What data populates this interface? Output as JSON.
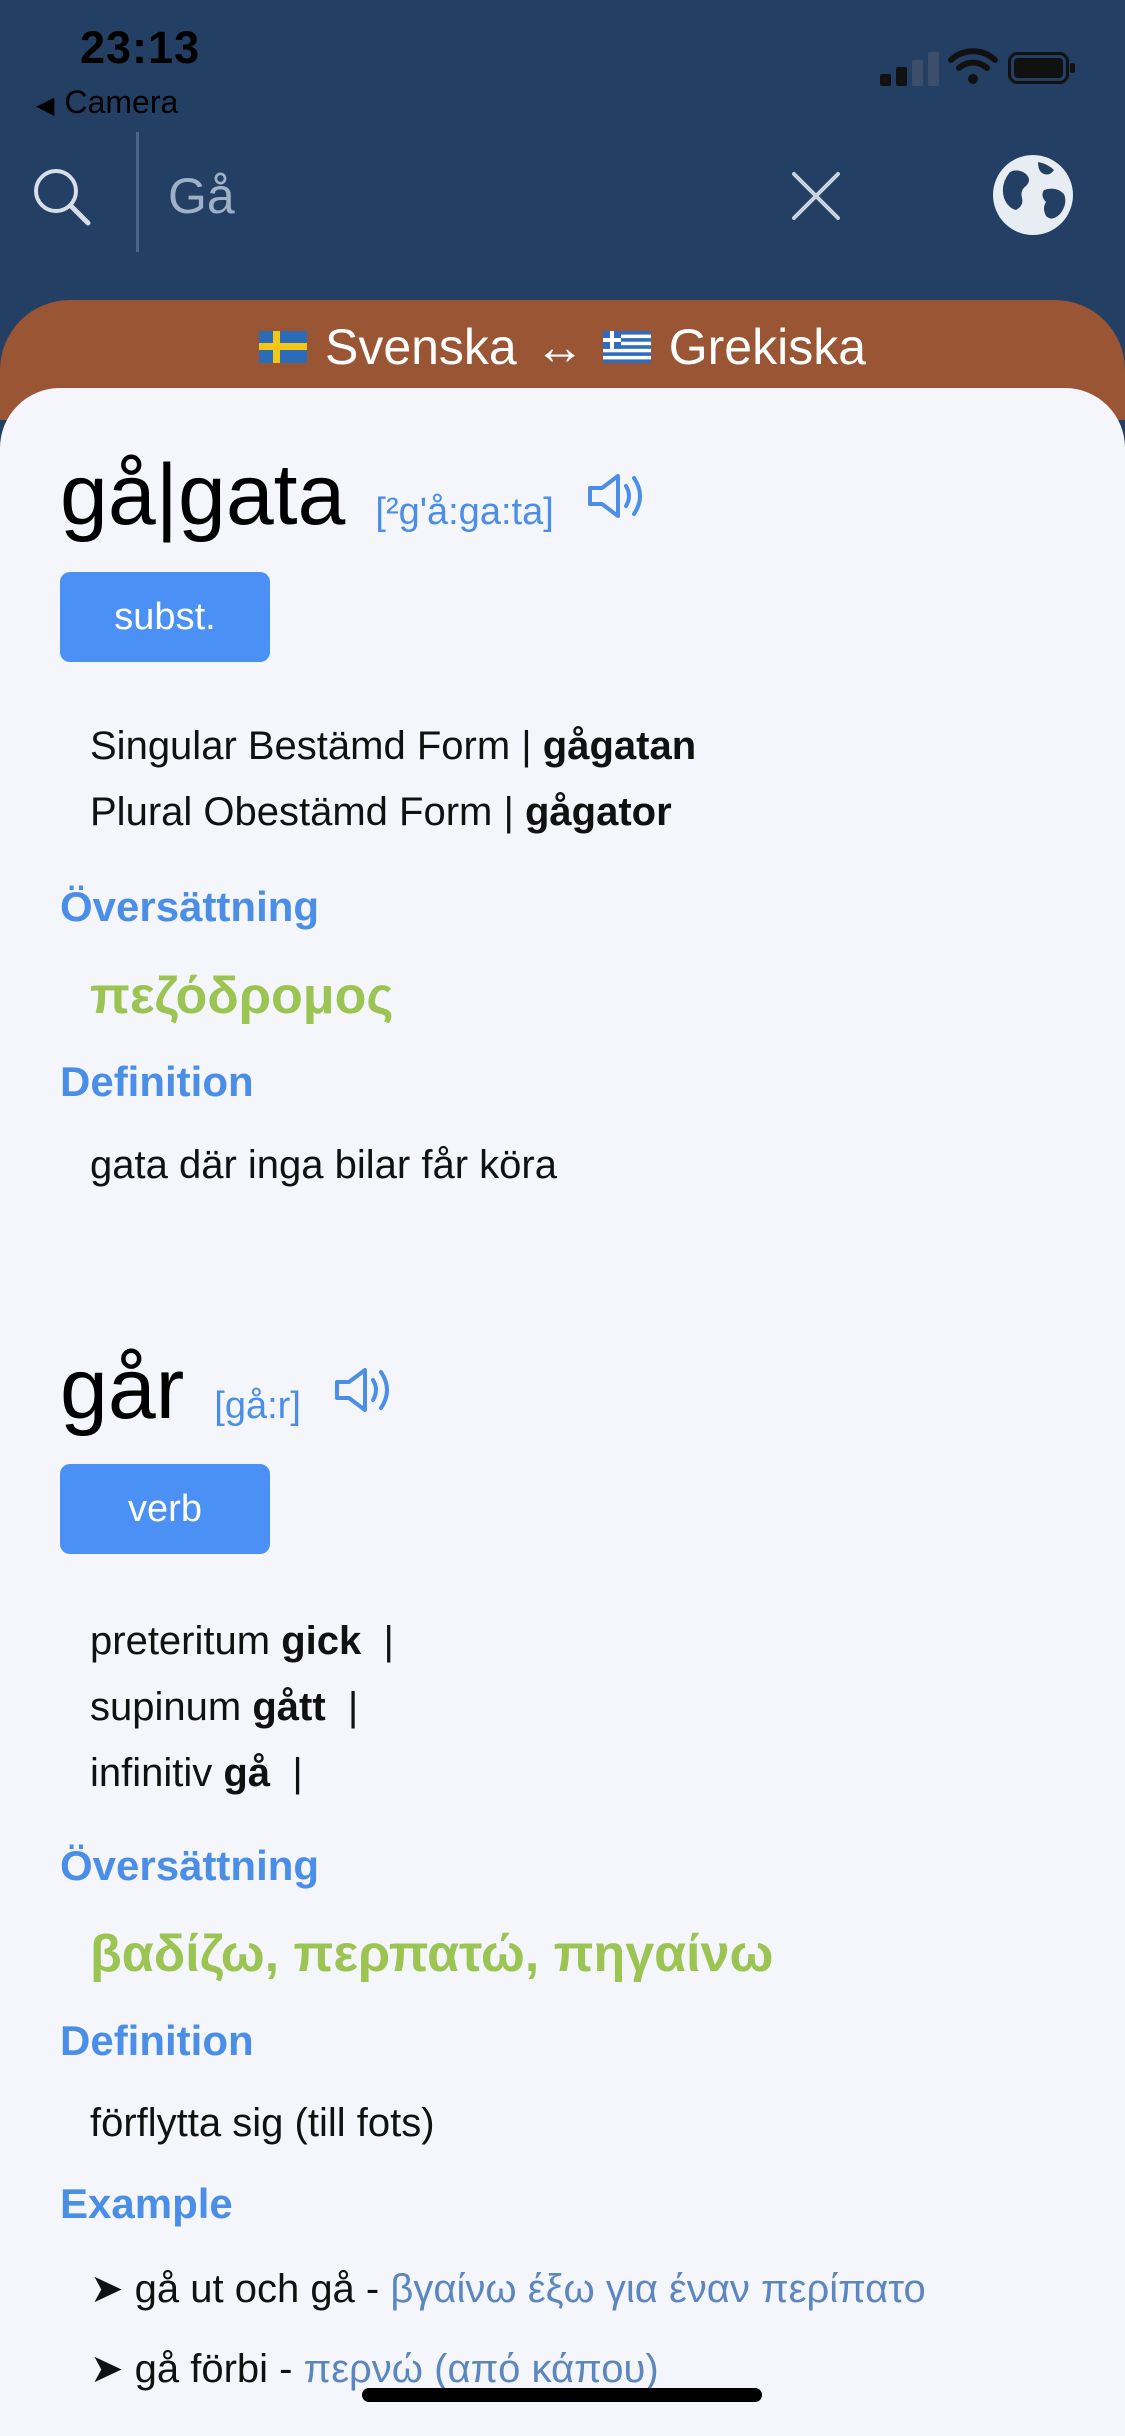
{
  "status_bar": {
    "time": "23:13",
    "back_label": "Camera"
  },
  "search": {
    "value": "Gå",
    "placeholder": ""
  },
  "language_bar": {
    "source": "Svenska",
    "target": "Grekiska",
    "swap": "↔"
  },
  "entries": [
    {
      "headword": "gå|gata",
      "pronunciation": "[²g'å:ga:ta]",
      "pos": "subst.",
      "forms": [
        {
          "label": "Singular Bestämd Form  |",
          "value": "gågatan"
        },
        {
          "label": "Plural Obestämd Form  |",
          "value": "gågator"
        }
      ],
      "translation_title": "Översättning",
      "translation": "πεζόδρομος",
      "definition_title": "Definition",
      "definition": "gata där inga bilar får köra"
    },
    {
      "headword": "går",
      "pronunciation": "[gå:r]",
      "pos": "verb",
      "forms": [
        {
          "label": "preteritum",
          "value": "gick",
          "sep": "|"
        },
        {
          "label": "supinum",
          "value": "gått",
          "sep": "|"
        },
        {
          "label": "infinitiv",
          "value": "gå",
          "sep": "|"
        }
      ],
      "translation_title": "Översättning",
      "translation": "βαδίζω, περπατώ, πηγαίνω",
      "definition_title": "Definition",
      "definition": "förflytta sig (till fots)",
      "example_title": "Example",
      "examples": [
        {
          "sv": "➤ gå ut och gå  -",
          "gr": "βγαίνω έξω για έναν περίπατο"
        },
        {
          "sv": "➤ gå förbi  -",
          "gr": "περνώ (από κάπου)"
        }
      ]
    }
  ],
  "colors": {
    "header_bg": "#243f64",
    "lang_bar_bg": "#9a5634",
    "accent_blue": "#4a8ee8",
    "translation_green": "#9bc452",
    "card_bg": "#f5f6fb"
  }
}
